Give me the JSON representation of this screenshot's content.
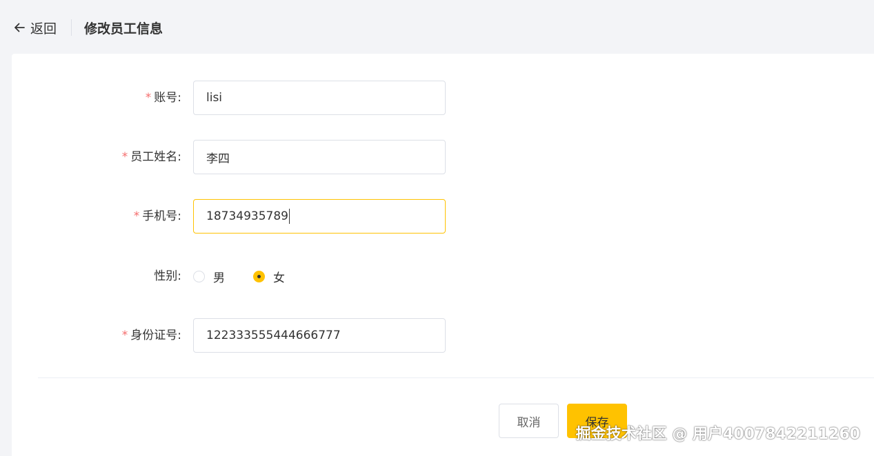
{
  "header": {
    "back_label": "返回",
    "title": "修改员工信息"
  },
  "form": {
    "account": {
      "label": "账号:",
      "required": "*",
      "value": "lisi"
    },
    "name": {
      "label": "员工姓名:",
      "required": "*",
      "value": "李四"
    },
    "phone": {
      "label": "手机号:",
      "required": "*",
      "value": "18734935789"
    },
    "gender": {
      "label": "性别:",
      "options": [
        {
          "label": "男",
          "checked": false
        },
        {
          "label": "女",
          "checked": true
        }
      ]
    },
    "id_number": {
      "label": "身份证号:",
      "required": "*",
      "value": "122333555444666777"
    }
  },
  "actions": {
    "cancel_label": "取消",
    "save_label": "保存"
  },
  "watermark": "掘金技术社区 @ 用户4007842211260",
  "colors": {
    "accent": "#ffc200",
    "required": "#f56c6c",
    "background": "#f3f4f7"
  },
  "icons": {
    "back": "arrow-left-icon"
  }
}
